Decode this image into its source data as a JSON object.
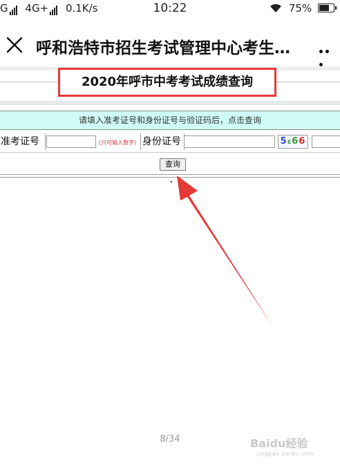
{
  "status_bar": {
    "network_left": "G",
    "network_type": "4G+",
    "speed": "0.1K/s",
    "time": "10:22",
    "battery": "75%",
    "battery_level": 0.75
  },
  "header": {
    "title": "呼和浩特市招生考试管理中心考生…",
    "close_icon": "close-icon",
    "more_icon": "more-dots-icon"
  },
  "page": {
    "heading": "2020年呼市中考考试成绩查询",
    "instruction": "请填入准考证号和身份证号与验证码后，点击查询",
    "ticket_label": "准考证号",
    "ticket_value": "",
    "ticket_hint": "(只可输入数字)",
    "id_label": "身份证号",
    "id_value": "",
    "captcha_chars": [
      "5",
      "6",
      "6"
    ],
    "captcha_value": "",
    "query_button": "查询",
    "page_number": "8/34"
  },
  "watermark": {
    "text": "Baidu经验",
    "url": "jingyan.baidu.com"
  },
  "colors": {
    "highlight_border": "#e53935",
    "instruction_bg": "#cffcf8",
    "arrow": "#e53935"
  }
}
